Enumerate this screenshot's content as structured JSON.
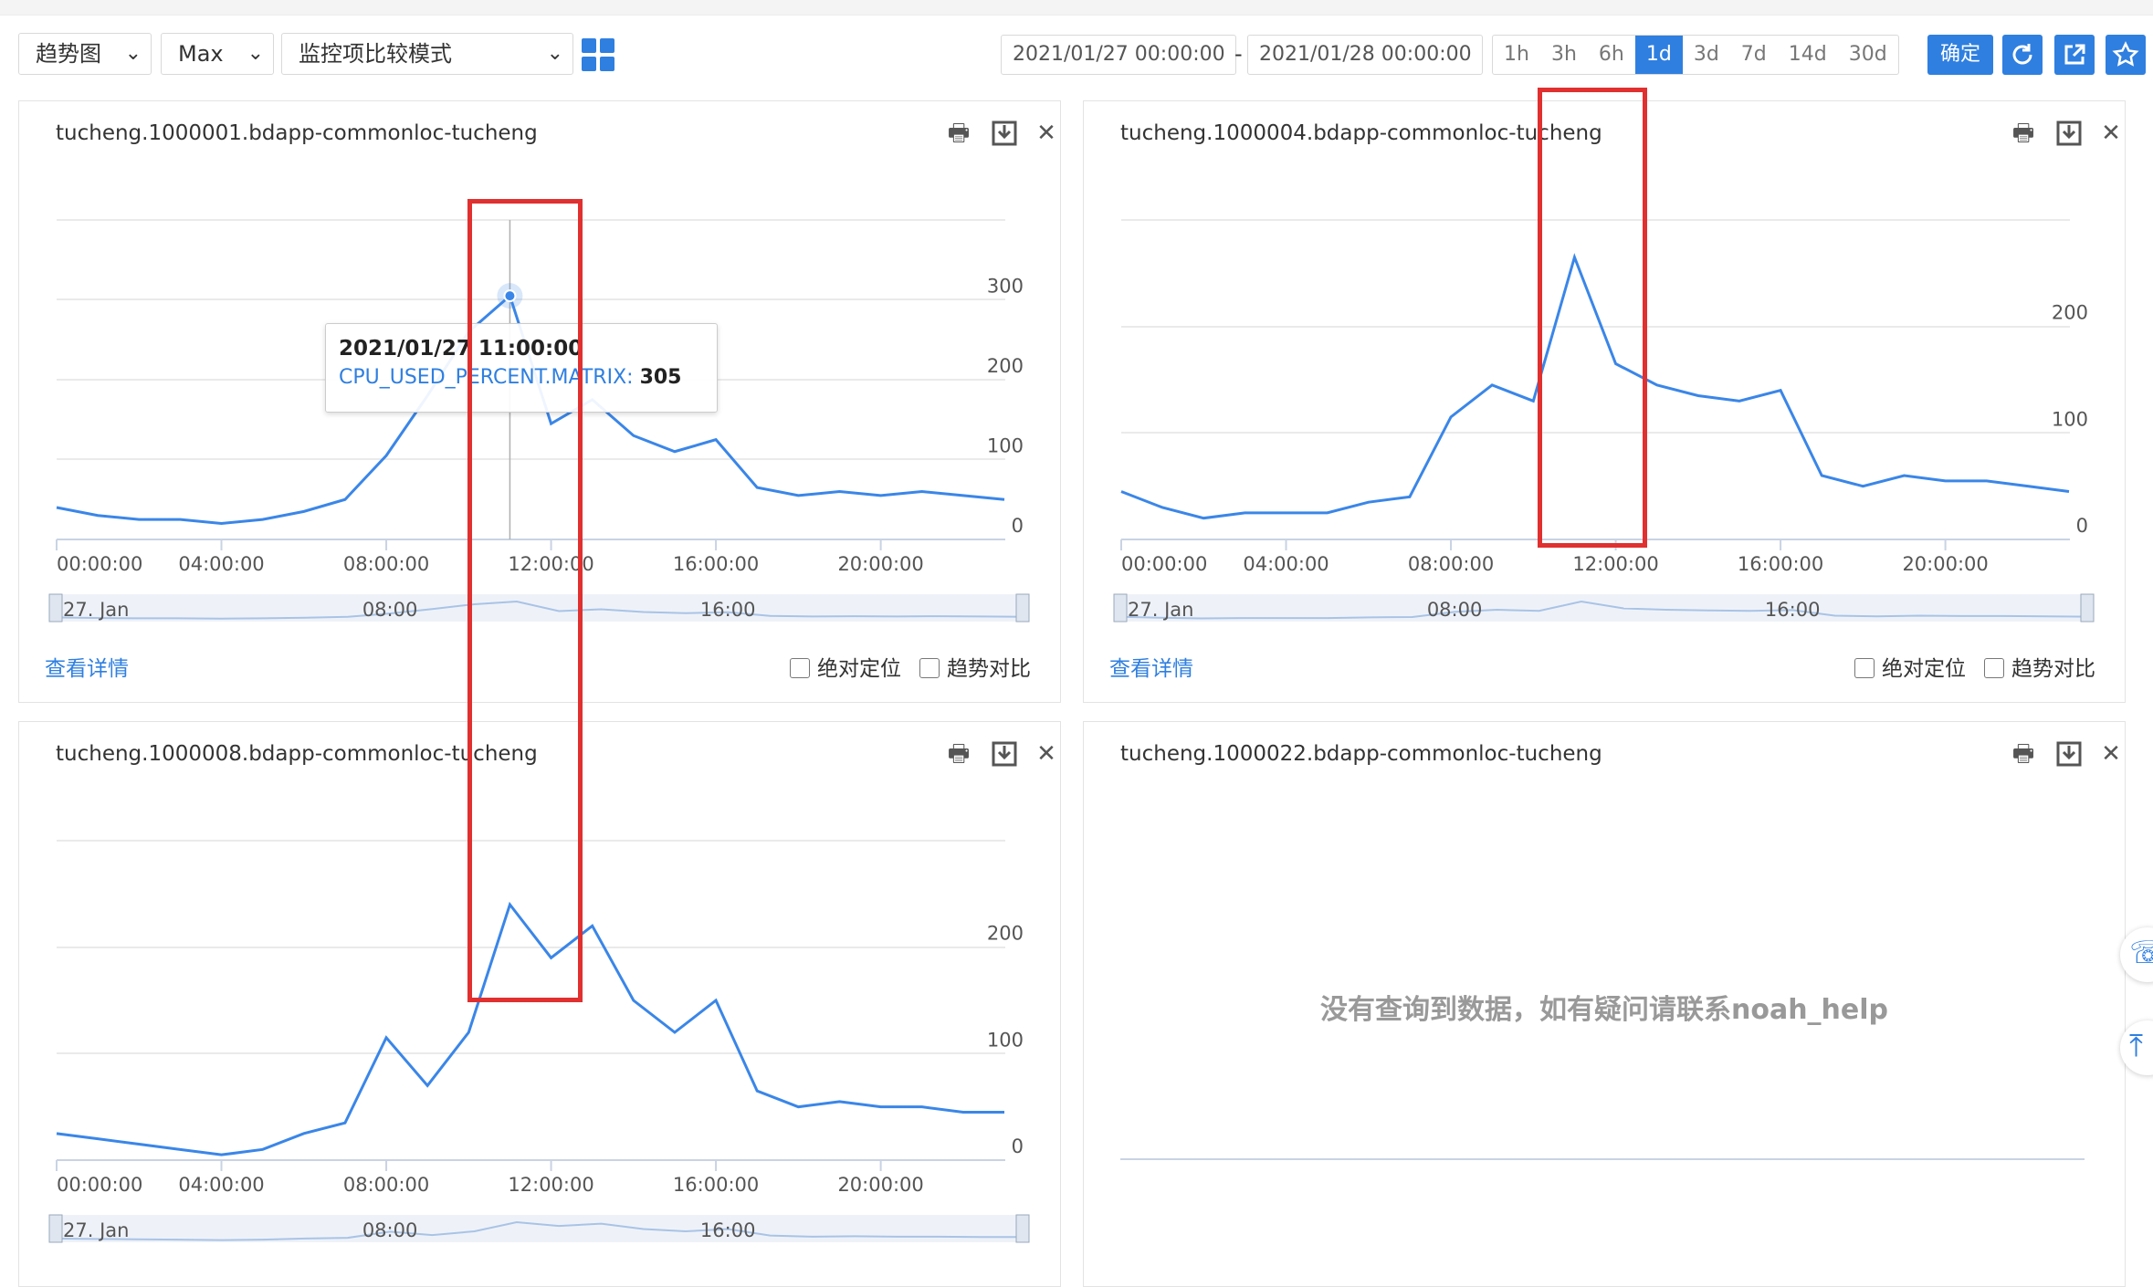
{
  "toolbar": {
    "view_select": "趋势图",
    "agg_select": "Max",
    "mode_select": "监控项比较模式",
    "start_time": "2021/01/27 00:00:00",
    "dash": "-",
    "end_time": "2021/01/28 00:00:00",
    "ranges": [
      "1h",
      "3h",
      "6h",
      "1d",
      "3d",
      "7d",
      "14d",
      "30d"
    ],
    "active_range": "1d",
    "confirm_label": "确定"
  },
  "accent_color": "#2f7fe0",
  "icons": [
    "chevron-down-icon",
    "grid-layout-icon",
    "refresh-icon",
    "export-icon",
    "star-icon",
    "print-icon",
    "download-icon",
    "close-icon",
    "checkbox-icon",
    "customer-service-icon",
    "back-to-top-icon"
  ],
  "panels": [
    {
      "title": "tucheng.1000001.bdapp-commonloc-tucheng",
      "y_ticks": [
        "300",
        "200",
        "100",
        "0"
      ],
      "x_ticks": [
        "00:00:00",
        "04:00:00",
        "08:00:00",
        "12:00:00",
        "16:00:00",
        "20:00:00"
      ],
      "navigator": {
        "date": "27. Jan",
        "ticks": [
          "08:00",
          "16:00"
        ]
      },
      "detail_link": "查看详情",
      "checkbox_abs": "绝对定位",
      "checkbox_trend": "趋势对比",
      "tooltip": {
        "time": "2021/01/27 11:00:00",
        "metric": "CPU_USED_PERCENT.MATRIX:",
        "value": "305"
      }
    },
    {
      "title": "tucheng.1000004.bdapp-commonloc-tucheng",
      "y_ticks": [
        "200",
        "100",
        "0"
      ],
      "x_ticks": [
        "00:00:00",
        "04:00:00",
        "08:00:00",
        "12:00:00",
        "16:00:00",
        "20:00:00"
      ],
      "navigator": {
        "date": "27. Jan",
        "ticks": [
          "08:00",
          "16:00"
        ]
      },
      "detail_link": "查看详情",
      "checkbox_abs": "绝对定位",
      "checkbox_trend": "趋势对比"
    },
    {
      "title": "tucheng.1000008.bdapp-commonloc-tucheng",
      "y_ticks": [
        "200",
        "100",
        "0"
      ],
      "x_ticks": [
        "00:00:00",
        "04:00:00",
        "08:00:00",
        "12:00:00",
        "16:00:00",
        "20:00:00"
      ],
      "navigator": {
        "date": "27. Jan",
        "ticks": [
          "08:00",
          "16:00"
        ]
      }
    },
    {
      "title": "tucheng.1000022.bdapp-commonloc-tucheng",
      "empty_message": "没有查询到数据，如有疑问请联系noah_help"
    }
  ],
  "chart_data": [
    {
      "type": "line",
      "series": [
        {
          "name": "CPU_USED_PERCENT.MATRIX",
          "x_hours": [
            0,
            1,
            2,
            3,
            4,
            5,
            6,
            7,
            8,
            9,
            10,
            11,
            12,
            13,
            14,
            15,
            16,
            17,
            18,
            19,
            20,
            21,
            22,
            23
          ],
          "values": [
            40,
            30,
            25,
            25,
            20,
            25,
            35,
            50,
            105,
            180,
            260,
            305,
            145,
            175,
            130,
            110,
            125,
            65,
            55,
            60,
            55,
            60,
            55,
            50
          ]
        }
      ],
      "ylim": [
        0,
        400
      ],
      "xlim": [
        "2021/01/27 00:00:00",
        "2021/01/27 23:00:00"
      ]
    },
    {
      "type": "line",
      "series": [
        {
          "x_hours": [
            0,
            1,
            2,
            3,
            4,
            5,
            6,
            7,
            8,
            9,
            10,
            11,
            12,
            13,
            14,
            15,
            16,
            17,
            18,
            19,
            20,
            21,
            22,
            23
          ],
          "values": [
            45,
            30,
            20,
            25,
            25,
            25,
            35,
            40,
            115,
            145,
            130,
            265,
            165,
            145,
            135,
            130,
            140,
            60,
            50,
            60,
            55,
            55,
            50,
            45
          ]
        }
      ],
      "ylim": [
        0,
        300
      ],
      "xlim": [
        "2021/01/27 00:00:00",
        "2021/01/27 23:00:00"
      ]
    },
    {
      "type": "line",
      "series": [
        {
          "x_hours": [
            0,
            1,
            2,
            3,
            4,
            5,
            6,
            7,
            8,
            9,
            10,
            11,
            12,
            13,
            14,
            15,
            16,
            17,
            18,
            19,
            20,
            21,
            22,
            23
          ],
          "values": [
            25,
            20,
            15,
            10,
            5,
            10,
            25,
            35,
            115,
            70,
            120,
            240,
            190,
            220,
            150,
            120,
            150,
            65,
            50,
            55,
            50,
            50,
            45,
            45
          ]
        }
      ],
      "ylim": [
        0,
        300
      ],
      "xlim": [
        "2021/01/27 00:00:00",
        "2021/01/27 23:00:00"
      ]
    }
  ]
}
